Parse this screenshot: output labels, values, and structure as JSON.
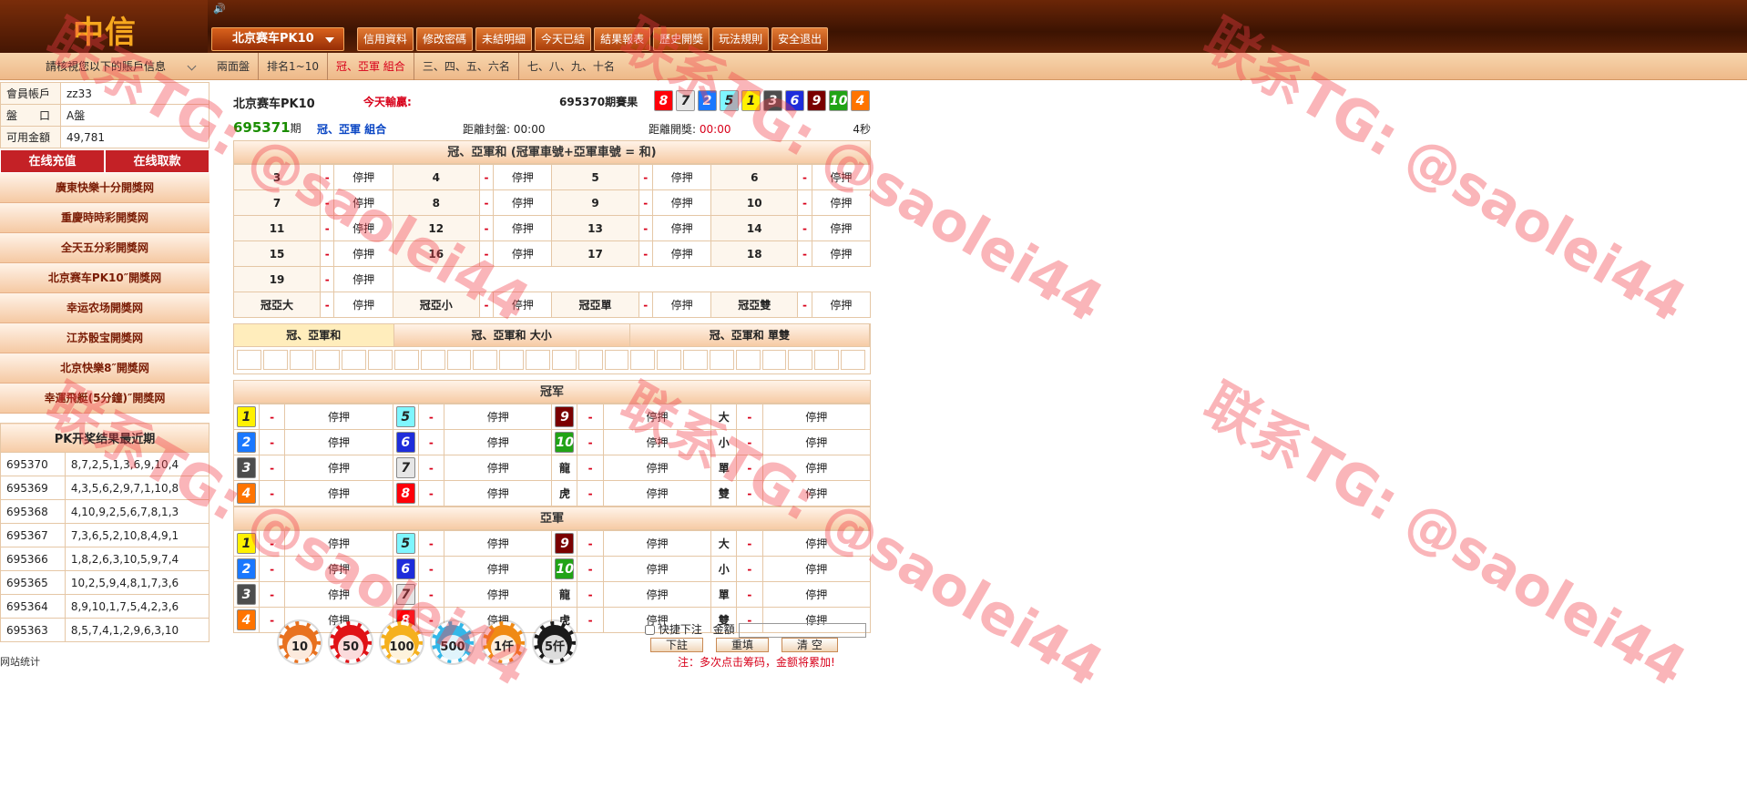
{
  "header": {
    "logo": "中信",
    "game": "北京赛车PK10",
    "menu": [
      "信用資料",
      "修改密碼",
      "未結明細",
      "今天已結",
      "結果報表",
      "歷史開獎",
      "玩法規則",
      "安全退出"
    ]
  },
  "subbar": {
    "notice": "請核視您以下的賬戶信息",
    "nav": [
      "兩面盤",
      "排名1~10",
      "冠、亞軍 組合",
      "三、四、五、六名",
      "七、八、九、十名"
    ]
  },
  "account": {
    "rows": [
      {
        "label": "會員帳戶",
        "value": "zz33"
      },
      {
        "label": "盤　　口",
        "value": "A盤"
      },
      {
        "label": "可用金額",
        "value": "49,781"
      }
    ],
    "deposit": "在线充值",
    "withdraw": "在线取款"
  },
  "links": [
    "廣東快樂十分開獎网",
    "重慶時時彩開獎网",
    "全天五分彩開獎网",
    "北京赛车PK10″開獎网",
    "幸运农场開獎网",
    "江苏骰宝開獎网",
    "北京快樂8″開獎网",
    "幸運飛艇(5分鐘)″開獎网"
  ],
  "history": {
    "title": "PK开奖结果最近期",
    "rows": [
      [
        "695370",
        "8,7,2,5,1,3,6,9,10,4"
      ],
      [
        "695369",
        "4,3,5,6,2,9,7,1,10,8"
      ],
      [
        "695368",
        "4,10,9,2,5,6,7,8,1,3"
      ],
      [
        "695367",
        "7,3,6,5,2,10,8,4,9,1"
      ],
      [
        "695366",
        "1,8,2,6,3,10,5,9,7,4"
      ],
      [
        "695365",
        "10,2,5,9,4,8,1,7,3,6"
      ],
      [
        "695364",
        "8,9,10,1,7,5,4,2,3,6"
      ],
      [
        "695363",
        "8,5,7,4,1,2,9,6,3,10"
      ]
    ]
  },
  "site_stats": "网站统计",
  "info": {
    "game": "北京赛车PK10",
    "today": "今天輸贏:",
    "last_label": "695370期賽果",
    "last_balls": [
      "8",
      "7",
      "2",
      "5",
      "1",
      "3",
      "6",
      "9",
      "10",
      "4"
    ],
    "period": "695371",
    "period_suffix": "期",
    "play_type": "冠、亞軍 組合",
    "close_label": "距離封盤:",
    "close_time": "00:00",
    "open_label": "距離開獎:",
    "open_time": "00:00",
    "secs": "4秒"
  },
  "sum_table": {
    "title": "冠、亞軍和 (冠軍車號+亞軍車號 = 和)",
    "cells": [
      [
        "3",
        "4",
        "5",
        "6"
      ],
      [
        "7",
        "8",
        "9",
        "10"
      ],
      [
        "11",
        "12",
        "13",
        "14"
      ],
      [
        "15",
        "16",
        "17",
        "18"
      ],
      [
        "19"
      ]
    ],
    "odds": "-",
    "status": "停押",
    "extra": [
      "冠亞大",
      "冠亞小",
      "冠亞單",
      "冠亞雙"
    ]
  },
  "sub_tabs": [
    "冠、亞軍和",
    "冠、亞軍和 大小",
    "冠、亞軍和 單雙"
  ],
  "champion": {
    "title": "冠军"
  },
  "runnerup": {
    "title": "亞軍"
  },
  "pos_opts": {
    "c1": [
      "1",
      "2",
      "3",
      "4"
    ],
    "c2": [
      "5",
      "6",
      "7",
      "8"
    ],
    "c3": [
      "9",
      "10",
      "龍",
      "虎"
    ],
    "c4": [
      "大",
      "小",
      "單",
      "雙"
    ]
  },
  "colors": {
    "1": "#fff100",
    "2": "#1a78ff",
    "3": "#4d4d4d",
    "4": "#ff7400",
    "5": "#7ff6ff",
    "6": "#1e2ddb",
    "7": "#e6e6e6",
    "8": "#ff0009",
    "9": "#7a0000",
    "10": "#22a316"
  },
  "chips": [
    "10",
    "50",
    "100",
    "500",
    "1仟",
    "5仟"
  ],
  "quick": {
    "label": "快捷下注",
    "amount": "金額",
    "bet": "下註",
    "reset": "重填",
    "clear": "清 空",
    "note": "注：多次点击筹码，金额将累加!"
  },
  "watermark": "联系TG: @saolei44"
}
